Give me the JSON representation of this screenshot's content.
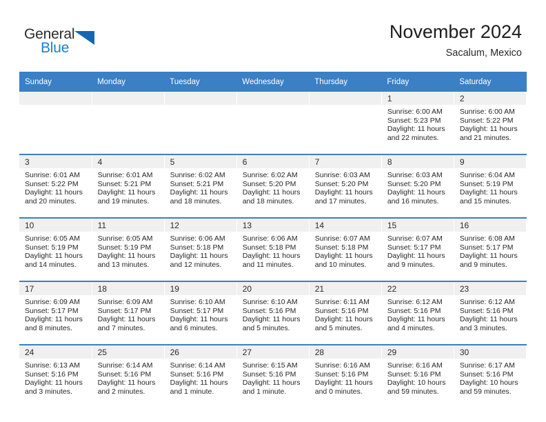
{
  "brand": {
    "name_part1": "General",
    "name_part2": "Blue",
    "accent_color": "#1a7fd4",
    "triangle_color": "#1567b5"
  },
  "header": {
    "title": "November 2024",
    "subtitle": "Sacalum, Mexico",
    "header_bg": "#3b7fc4"
  },
  "calendar": {
    "weekday_headers": [
      "Sunday",
      "Monday",
      "Tuesday",
      "Wednesday",
      "Thursday",
      "Friday",
      "Saturday"
    ],
    "weeks": [
      [
        {
          "day": "",
          "empty": true
        },
        {
          "day": "",
          "empty": true
        },
        {
          "day": "",
          "empty": true
        },
        {
          "day": "",
          "empty": true
        },
        {
          "day": "",
          "empty": true
        },
        {
          "day": "1",
          "sunrise": "Sunrise: 6:00 AM",
          "sunset": "Sunset: 5:23 PM",
          "daylight_line1": "Daylight: 11 hours",
          "daylight_line2": "and 22 minutes."
        },
        {
          "day": "2",
          "sunrise": "Sunrise: 6:00 AM",
          "sunset": "Sunset: 5:22 PM",
          "daylight_line1": "Daylight: 11 hours",
          "daylight_line2": "and 21 minutes."
        }
      ],
      [
        {
          "day": "3",
          "sunrise": "Sunrise: 6:01 AM",
          "sunset": "Sunset: 5:22 PM",
          "daylight_line1": "Daylight: 11 hours",
          "daylight_line2": "and 20 minutes."
        },
        {
          "day": "4",
          "sunrise": "Sunrise: 6:01 AM",
          "sunset": "Sunset: 5:21 PM",
          "daylight_line1": "Daylight: 11 hours",
          "daylight_line2": "and 19 minutes."
        },
        {
          "day": "5",
          "sunrise": "Sunrise: 6:02 AM",
          "sunset": "Sunset: 5:21 PM",
          "daylight_line1": "Daylight: 11 hours",
          "daylight_line2": "and 18 minutes."
        },
        {
          "day": "6",
          "sunrise": "Sunrise: 6:02 AM",
          "sunset": "Sunset: 5:20 PM",
          "daylight_line1": "Daylight: 11 hours",
          "daylight_line2": "and 18 minutes."
        },
        {
          "day": "7",
          "sunrise": "Sunrise: 6:03 AM",
          "sunset": "Sunset: 5:20 PM",
          "daylight_line1": "Daylight: 11 hours",
          "daylight_line2": "and 17 minutes."
        },
        {
          "day": "8",
          "sunrise": "Sunrise: 6:03 AM",
          "sunset": "Sunset: 5:20 PM",
          "daylight_line1": "Daylight: 11 hours",
          "daylight_line2": "and 16 minutes."
        },
        {
          "day": "9",
          "sunrise": "Sunrise: 6:04 AM",
          "sunset": "Sunset: 5:19 PM",
          "daylight_line1": "Daylight: 11 hours",
          "daylight_line2": "and 15 minutes."
        }
      ],
      [
        {
          "day": "10",
          "sunrise": "Sunrise: 6:05 AM",
          "sunset": "Sunset: 5:19 PM",
          "daylight_line1": "Daylight: 11 hours",
          "daylight_line2": "and 14 minutes."
        },
        {
          "day": "11",
          "sunrise": "Sunrise: 6:05 AM",
          "sunset": "Sunset: 5:19 PM",
          "daylight_line1": "Daylight: 11 hours",
          "daylight_line2": "and 13 minutes."
        },
        {
          "day": "12",
          "sunrise": "Sunrise: 6:06 AM",
          "sunset": "Sunset: 5:18 PM",
          "daylight_line1": "Daylight: 11 hours",
          "daylight_line2": "and 12 minutes."
        },
        {
          "day": "13",
          "sunrise": "Sunrise: 6:06 AM",
          "sunset": "Sunset: 5:18 PM",
          "daylight_line1": "Daylight: 11 hours",
          "daylight_line2": "and 11 minutes."
        },
        {
          "day": "14",
          "sunrise": "Sunrise: 6:07 AM",
          "sunset": "Sunset: 5:18 PM",
          "daylight_line1": "Daylight: 11 hours",
          "daylight_line2": "and 10 minutes."
        },
        {
          "day": "15",
          "sunrise": "Sunrise: 6:07 AM",
          "sunset": "Sunset: 5:17 PM",
          "daylight_line1": "Daylight: 11 hours",
          "daylight_line2": "and 9 minutes."
        },
        {
          "day": "16",
          "sunrise": "Sunrise: 6:08 AM",
          "sunset": "Sunset: 5:17 PM",
          "daylight_line1": "Daylight: 11 hours",
          "daylight_line2": "and 9 minutes."
        }
      ],
      [
        {
          "day": "17",
          "sunrise": "Sunrise: 6:09 AM",
          "sunset": "Sunset: 5:17 PM",
          "daylight_line1": "Daylight: 11 hours",
          "daylight_line2": "and 8 minutes."
        },
        {
          "day": "18",
          "sunrise": "Sunrise: 6:09 AM",
          "sunset": "Sunset: 5:17 PM",
          "daylight_line1": "Daylight: 11 hours",
          "daylight_line2": "and 7 minutes."
        },
        {
          "day": "19",
          "sunrise": "Sunrise: 6:10 AM",
          "sunset": "Sunset: 5:17 PM",
          "daylight_line1": "Daylight: 11 hours",
          "daylight_line2": "and 6 minutes."
        },
        {
          "day": "20",
          "sunrise": "Sunrise: 6:10 AM",
          "sunset": "Sunset: 5:16 PM",
          "daylight_line1": "Daylight: 11 hours",
          "daylight_line2": "and 5 minutes."
        },
        {
          "day": "21",
          "sunrise": "Sunrise: 6:11 AM",
          "sunset": "Sunset: 5:16 PM",
          "daylight_line1": "Daylight: 11 hours",
          "daylight_line2": "and 5 minutes."
        },
        {
          "day": "22",
          "sunrise": "Sunrise: 6:12 AM",
          "sunset": "Sunset: 5:16 PM",
          "daylight_line1": "Daylight: 11 hours",
          "daylight_line2": "and 4 minutes."
        },
        {
          "day": "23",
          "sunrise": "Sunrise: 6:12 AM",
          "sunset": "Sunset: 5:16 PM",
          "daylight_line1": "Daylight: 11 hours",
          "daylight_line2": "and 3 minutes."
        }
      ],
      [
        {
          "day": "24",
          "sunrise": "Sunrise: 6:13 AM",
          "sunset": "Sunset: 5:16 PM",
          "daylight_line1": "Daylight: 11 hours",
          "daylight_line2": "and 3 minutes."
        },
        {
          "day": "25",
          "sunrise": "Sunrise: 6:14 AM",
          "sunset": "Sunset: 5:16 PM",
          "daylight_line1": "Daylight: 11 hours",
          "daylight_line2": "and 2 minutes."
        },
        {
          "day": "26",
          "sunrise": "Sunrise: 6:14 AM",
          "sunset": "Sunset: 5:16 PM",
          "daylight_line1": "Daylight: 11 hours",
          "daylight_line2": "and 1 minute."
        },
        {
          "day": "27",
          "sunrise": "Sunrise: 6:15 AM",
          "sunset": "Sunset: 5:16 PM",
          "daylight_line1": "Daylight: 11 hours",
          "daylight_line2": "and 1 minute."
        },
        {
          "day": "28",
          "sunrise": "Sunrise: 6:16 AM",
          "sunset": "Sunset: 5:16 PM",
          "daylight_line1": "Daylight: 11 hours",
          "daylight_line2": "and 0 minutes."
        },
        {
          "day": "29",
          "sunrise": "Sunrise: 6:16 AM",
          "sunset": "Sunset: 5:16 PM",
          "daylight_line1": "Daylight: 10 hours",
          "daylight_line2": "and 59 minutes."
        },
        {
          "day": "30",
          "sunrise": "Sunrise: 6:17 AM",
          "sunset": "Sunset: 5:16 PM",
          "daylight_line1": "Daylight: 10 hours",
          "daylight_line2": "and 59 minutes."
        }
      ]
    ]
  }
}
